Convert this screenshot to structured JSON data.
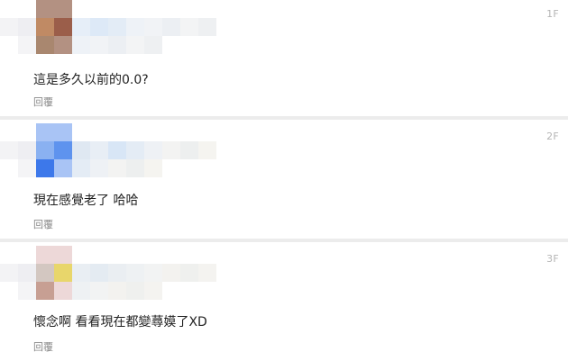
{
  "comments": [
    {
      "floor": "1F",
      "text": "這是多久以前的0.0?",
      "reply_label": "回覆",
      "avatar_palette": [
        "#c08a64",
        "#9b5e4a",
        "#a9876f",
        "#b39182"
      ]
    },
    {
      "floor": "2F",
      "text": "現在感覺老了 哈哈",
      "reply_label": "回覆",
      "avatar_palette": [
        "#8ab1f1",
        "#5e93ee",
        "#3d78ea",
        "#a9c4f5"
      ]
    },
    {
      "floor": "3F",
      "text": "懷念啊 看看現在都變蕁嫫了XD",
      "reply_label": "回覆",
      "avatar_palette": [
        "#d3c7c1",
        "#e8d66b",
        "#c79f93",
        "#edd8d8"
      ]
    }
  ]
}
